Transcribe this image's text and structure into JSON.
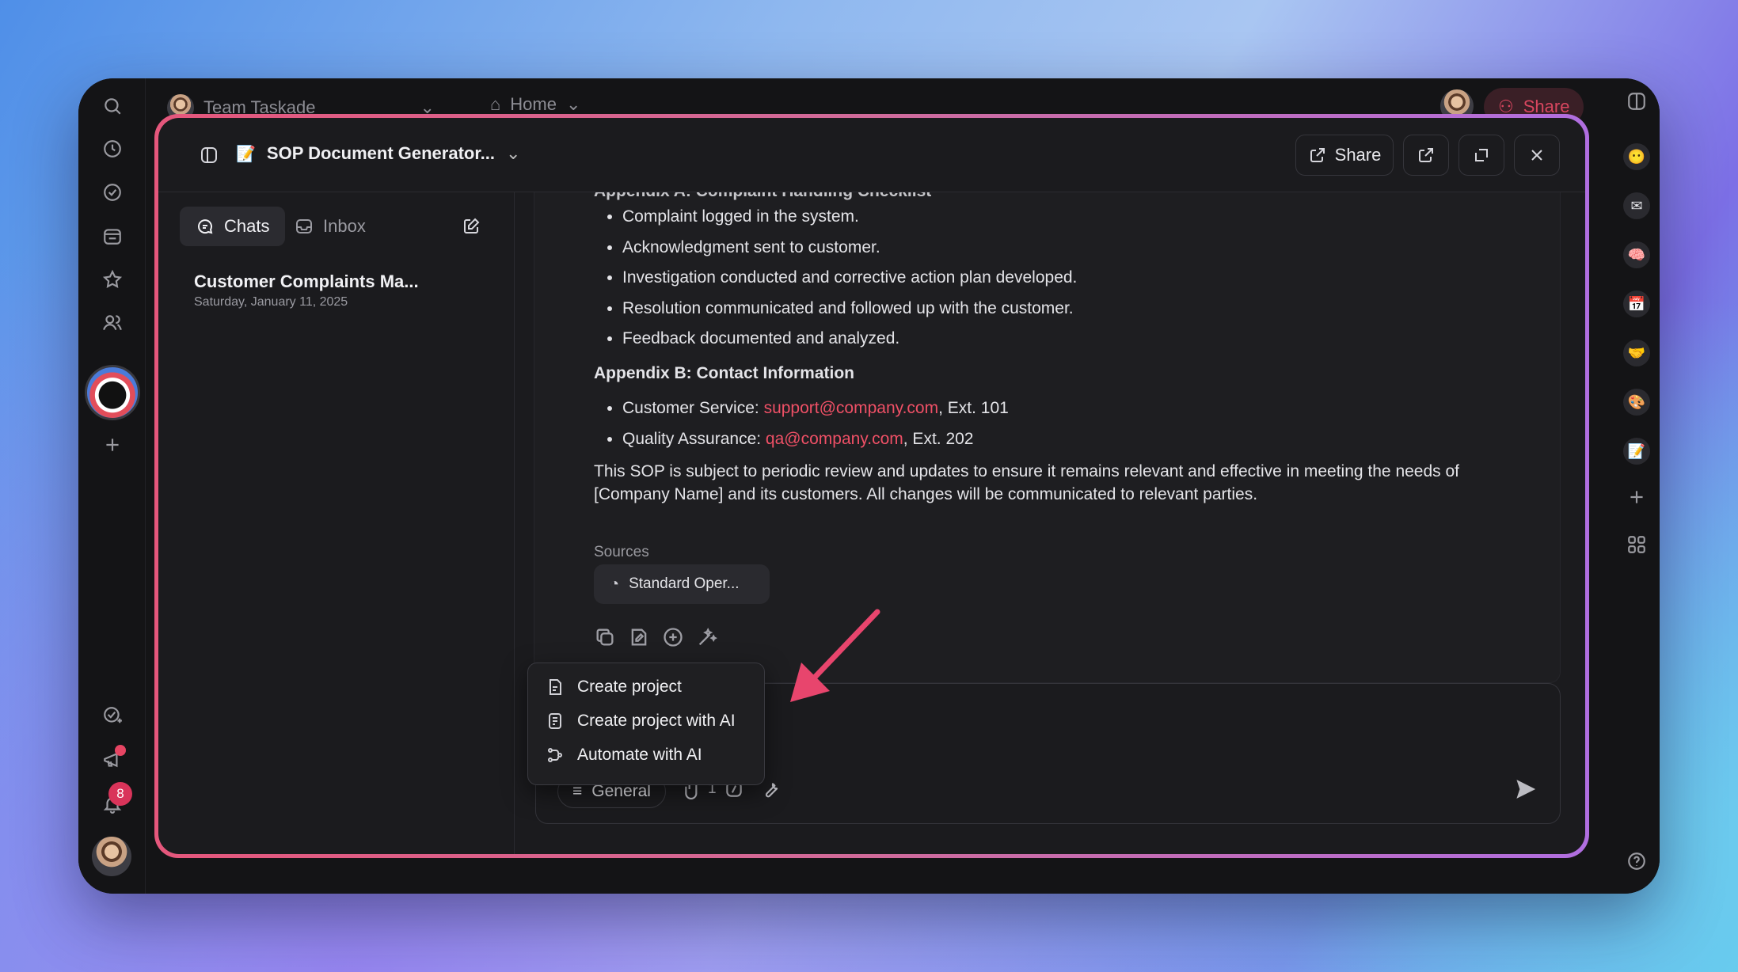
{
  "app": {
    "workspace_name": "Team Taskade",
    "home_label": "Home",
    "share_label_bg": "Share",
    "notification_count": "8"
  },
  "modal": {
    "title": "SOP Document Generator...",
    "share_label": "Share",
    "tabs": [
      {
        "label": "Chats",
        "active": true
      },
      {
        "label": "Inbox",
        "active": false
      }
    ],
    "chat_item": {
      "title": "Customer Complaints Ma...",
      "date": "Saturday, January 11, 2025"
    }
  },
  "content": {
    "partial_heading": "Appendix A: Complaint Handling Checklist",
    "checklist": [
      "Complaint logged in the system.",
      "Acknowledgment sent to customer.",
      "Investigation conducted and corrective action plan developed.",
      "Resolution communicated and followed up with the customer.",
      "Feedback documented and analyzed."
    ],
    "appendix_b_heading": "Appendix B: Contact Information",
    "contacts": [
      {
        "label": "Customer Service: ",
        "email": "support@company.com",
        "ext": ", Ext. 101"
      },
      {
        "label": "Quality Assurance: ",
        "email": "qa@company.com",
        "ext": ", Ext. 202"
      }
    ],
    "closing_line1": "This SOP is subject to periodic review and updates to ensure it remains relevant and effective in meeting the needs of",
    "closing_line2": "[Company Name] and its customers. All changes will be communicated to relevant parties.",
    "sources_label": "Sources",
    "source_chip": "Standard Oper..."
  },
  "menu": {
    "items": [
      {
        "label": "Create project",
        "icon": "document-icon"
      },
      {
        "label": "Create project with AI",
        "icon": "ai-document-icon"
      },
      {
        "label": "Automate with AI",
        "icon": "automation-icon"
      }
    ]
  },
  "input": {
    "mode_label": "General",
    "attachment_count": "1"
  },
  "colors": {
    "accent_link": "#ef5066",
    "modal_border_start": "#e5577c",
    "modal_border_end": "#b06ee0",
    "arrow": "#e8456d"
  }
}
